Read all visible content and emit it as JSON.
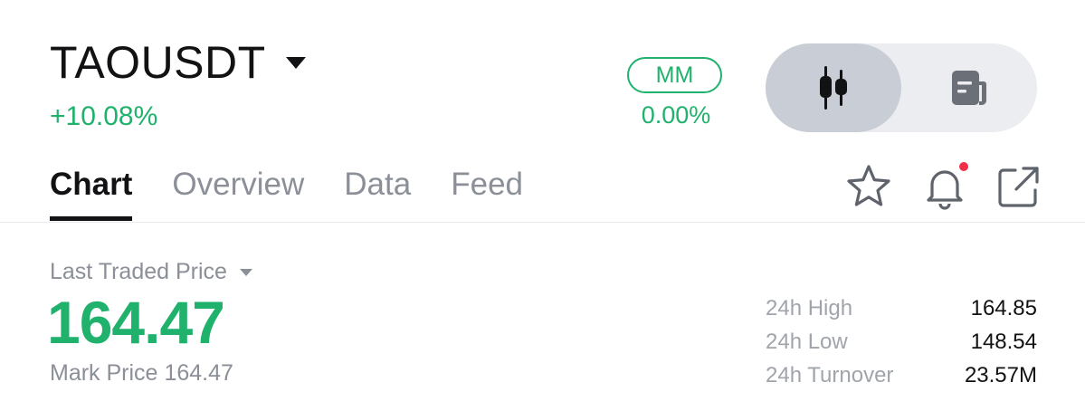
{
  "header": {
    "symbol": "TAOUSDT",
    "change_pct": "+10.08%",
    "mm_label": "MM",
    "mm_value": "0.00%",
    "view_toggle": {
      "selected": "candlestick-chart",
      "options": [
        "candlestick-icon",
        "document-icon"
      ]
    }
  },
  "tabs": [
    {
      "label": "Chart",
      "active": true
    },
    {
      "label": "Overview",
      "active": false
    },
    {
      "label": "Data",
      "active": false
    },
    {
      "label": "Feed",
      "active": false
    }
  ],
  "actions": [
    "star-icon",
    "bell-icon",
    "share-icon"
  ],
  "price": {
    "label": "Last Traded Price",
    "value": "164.47",
    "mark_label": "Mark Price",
    "mark_value": "164.47"
  },
  "stats": [
    {
      "label": "24h High",
      "value": "164.85"
    },
    {
      "label": "24h Low",
      "value": "148.54"
    },
    {
      "label": "24h Turnover",
      "value": "23.57M"
    }
  ],
  "colors": {
    "positive": "#20b26c",
    "text": "#121214",
    "muted": "#8b8f98",
    "notification_dot": "#f0304a"
  }
}
